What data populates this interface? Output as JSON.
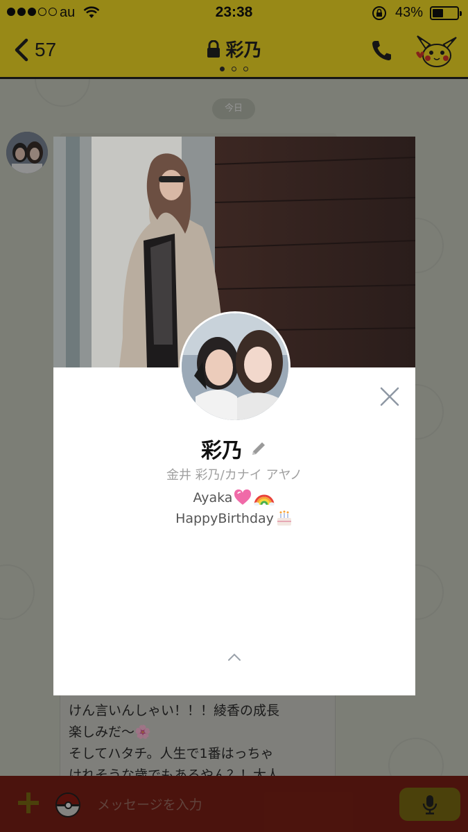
{
  "status_bar": {
    "carrier": "au",
    "time": "23:38",
    "battery_percent_label": "43%",
    "battery_level": 0.43,
    "signal_bars_filled": 3,
    "signal_bars_total": 5
  },
  "nav": {
    "back_count": "57",
    "title": "彩乃",
    "page_dots": 3,
    "active_page": 0
  },
  "chat": {
    "date_chip": "今日",
    "message_text": "ッ十支に恋うたり、もう何でもいい\nけん言いんしゃい！！！綾香の成長\n楽しみだ〜🌸\nそしてハタチ。人生で1番はっちゃ\nけれそうな歳でもあるやん？！大人"
  },
  "input_bar": {
    "placeholder": "メッセージを入力"
  },
  "profile": {
    "name": "彩乃",
    "sub_name": "金井 彩乃/カナイ アヤノ",
    "status_line_1": "Ayaka",
    "status_line_2": "HappyBirthday"
  },
  "icons": {
    "back": "chevron-left-icon",
    "lock": "lock-icon",
    "call": "phone-icon",
    "pikachu": "pikachu-icon",
    "close": "close-icon",
    "edit": "pencil-icon",
    "expand": "chevron-up-icon",
    "plus": "plus-icon",
    "pokeball": "pokeball-icon",
    "mic": "microphone-icon",
    "heart": "pink-heart-emoji",
    "rainbow": "rainbow-emoji",
    "cake": "birthday-cake-emoji"
  },
  "colors": {
    "header_yellow": "#f5dd26",
    "input_bar": "#7a2015",
    "modal_bg": "#ffffff"
  }
}
